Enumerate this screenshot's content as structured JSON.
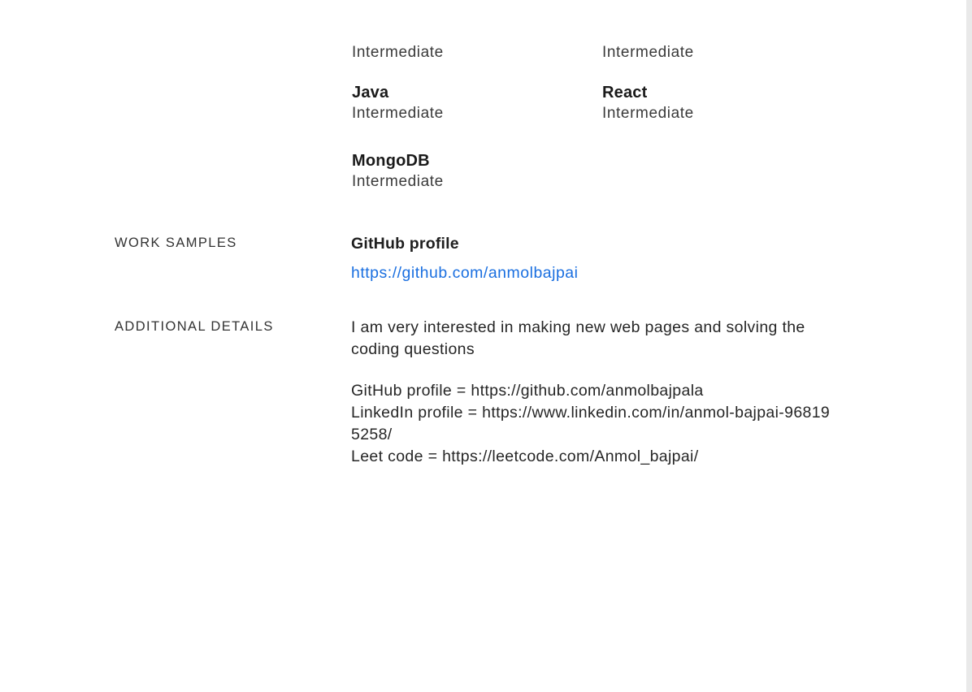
{
  "skills": [
    {
      "name": "",
      "level": "Intermediate"
    },
    {
      "name": "",
      "level": "Intermediate"
    },
    {
      "name": "Java",
      "level": "Intermediate"
    },
    {
      "name": "React",
      "level": "Intermediate"
    },
    {
      "name": "MongoDB",
      "level": "Intermediate"
    }
  ],
  "work_samples": {
    "label": "WORK SAMPLES",
    "title": "GitHub profile",
    "link": "https://github.com/anmolbajpai"
  },
  "additional_details": {
    "label": "ADDITIONAL DETAILS",
    "paragraph": "I am very interested in making new web pages and solving the coding questions",
    "lines": [
      "GitHub profile = https://github.com/anmolbajpala",
      "LinkedIn profile = https://www.linkedin.com/in/anmol-bajpai-968195258/",
      "Leet code = https://leetcode.com/Anmol_bajpai/"
    ]
  },
  "colors": {
    "link": "#1a6fe0",
    "text": "#262626",
    "background": "#ffffff"
  }
}
